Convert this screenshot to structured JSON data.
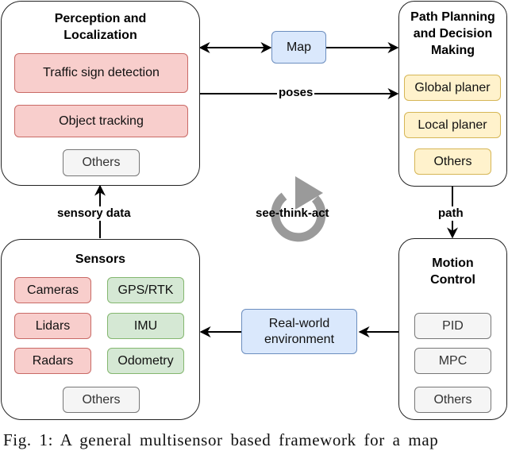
{
  "diagram": {
    "perception": {
      "title": "Perception and Localization",
      "title_lines": [
        "Perception and",
        "Localization"
      ],
      "items": [
        {
          "label": "Traffic sign detection",
          "color": "#f8cecc"
        },
        {
          "label": "Object tracking",
          "color": "#f8cecc"
        },
        {
          "label": "Others",
          "color": "#f5f5f5"
        }
      ]
    },
    "planning": {
      "title": "Path Planning and Decision Making",
      "title_lines": [
        "Path Planning",
        "and Decision",
        "Making"
      ],
      "items": [
        {
          "label": "Global planer",
          "color": "#fff2cc"
        },
        {
          "label": "Local planer",
          "color": "#fff2cc"
        },
        {
          "label": "Others",
          "color": "#fff2cc"
        }
      ]
    },
    "sensors": {
      "title": "Sensors",
      "items": [
        {
          "label": "Cameras",
          "color": "#f8cecc"
        },
        {
          "label": "GPS/RTK",
          "color": "#d5e8d4"
        },
        {
          "label": "Lidars",
          "color": "#f8cecc"
        },
        {
          "label": "IMU",
          "color": "#d5e8d4"
        },
        {
          "label": "Radars",
          "color": "#f8cecc"
        },
        {
          "label": "Odometry",
          "color": "#d5e8d4"
        },
        {
          "label": "Others",
          "color": "#f5f5f5"
        }
      ]
    },
    "motion": {
      "title": "Motion Control",
      "title_lines": [
        "Motion",
        "Control"
      ],
      "items": [
        {
          "label": "PID",
          "color": "#f5f5f5"
        },
        {
          "label": "MPC",
          "color": "#f5f5f5"
        },
        {
          "label": "Others",
          "color": "#f5f5f5"
        }
      ]
    },
    "map": {
      "label": "Map",
      "color": "#dae8fc"
    },
    "environment": {
      "label_lines": [
        "Real-world",
        "environment"
      ],
      "color": "#dae8fc"
    },
    "edges": {
      "poses": "poses",
      "sensory_data": "sensory data",
      "path": "path",
      "cycle": "see-think-act"
    },
    "caption": "Fig. 1: A general multisensor based framework for a map"
  }
}
